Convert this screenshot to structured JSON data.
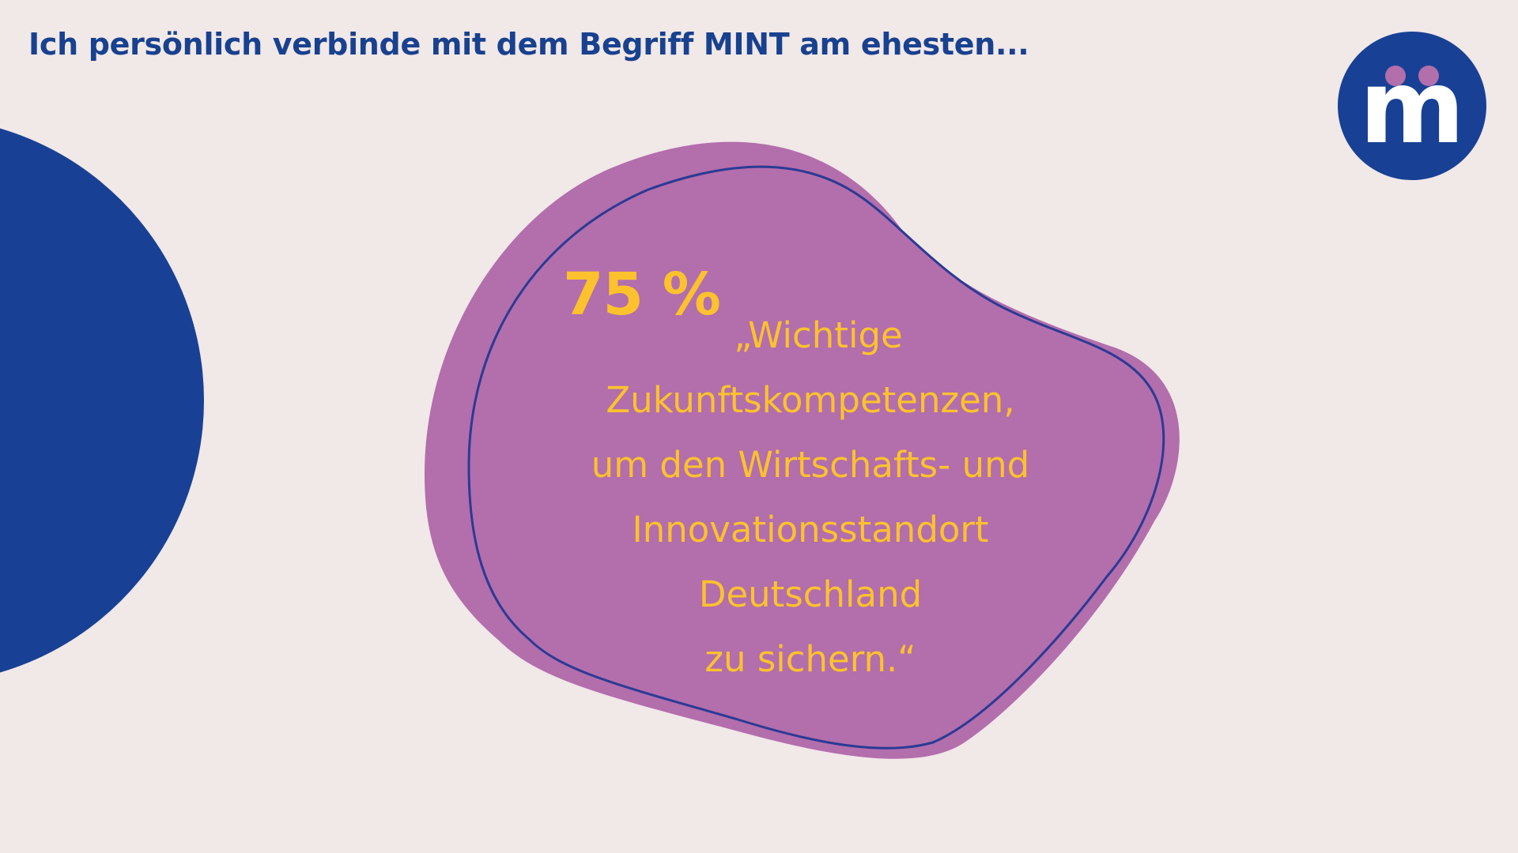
{
  "slide": {
    "title": "Ich persönlich verbinde mit dem Begriff MINT am ehesten...",
    "stat_value": "75 %",
    "quote_lines": [
      "„Wichtige",
      "Zukunftskompetenzen,",
      "um den Wirtschafts- und",
      "Innovationsstandort",
      "Deutschland",
      "zu sichern.“"
    ]
  },
  "logo": {
    "letter": "m",
    "icon": "mi-logo-icon"
  },
  "colors": {
    "background": "#f1e8e8",
    "dark_blue": "#184195",
    "purple": "#b36eac",
    "yellow": "#fbc22d",
    "logo_dots": "#b36eac"
  }
}
